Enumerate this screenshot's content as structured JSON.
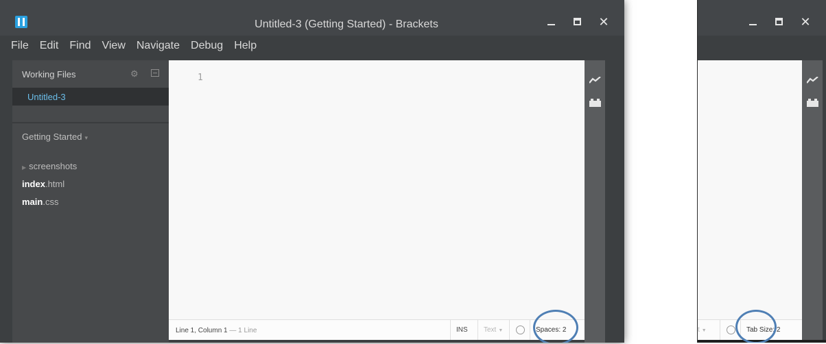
{
  "window": {
    "title": "Untitled-3 (Getting Started) - Brackets",
    "minimize": "minimize",
    "maximize": "maximize",
    "close": "✕"
  },
  "menu": [
    "File",
    "Edit",
    "Find",
    "View",
    "Navigate",
    "Debug",
    "Help"
  ],
  "sidebar": {
    "working_files_title": "Working Files",
    "working_files": [
      "Untitled-3"
    ],
    "project_title": "Getting Started",
    "tree": [
      {
        "name": "screenshots",
        "type": "folder"
      },
      {
        "name": "index",
        "ext": ".html",
        "type": "file"
      },
      {
        "name": "main",
        "ext": ".css",
        "type": "file"
      }
    ]
  },
  "editor": {
    "line_numbers": [
      "1"
    ]
  },
  "status": {
    "position": "Line 1, Column 1",
    "separator": " — ",
    "line_count": "1 Line",
    "mode": "INS",
    "language": "Text",
    "language_partial": "t",
    "spaces": "Spaces: 2",
    "tab_size": "Tab Size: 2"
  },
  "icons": {
    "live_preview": "live-preview-icon",
    "extension_manager": "extension-manager-icon",
    "gear": "gear-icon",
    "split": "split-view-icon",
    "lint": "lint-status-icon"
  },
  "colors": {
    "accent": "#6bbeea",
    "highlight_ring": "#4f7fb4"
  }
}
